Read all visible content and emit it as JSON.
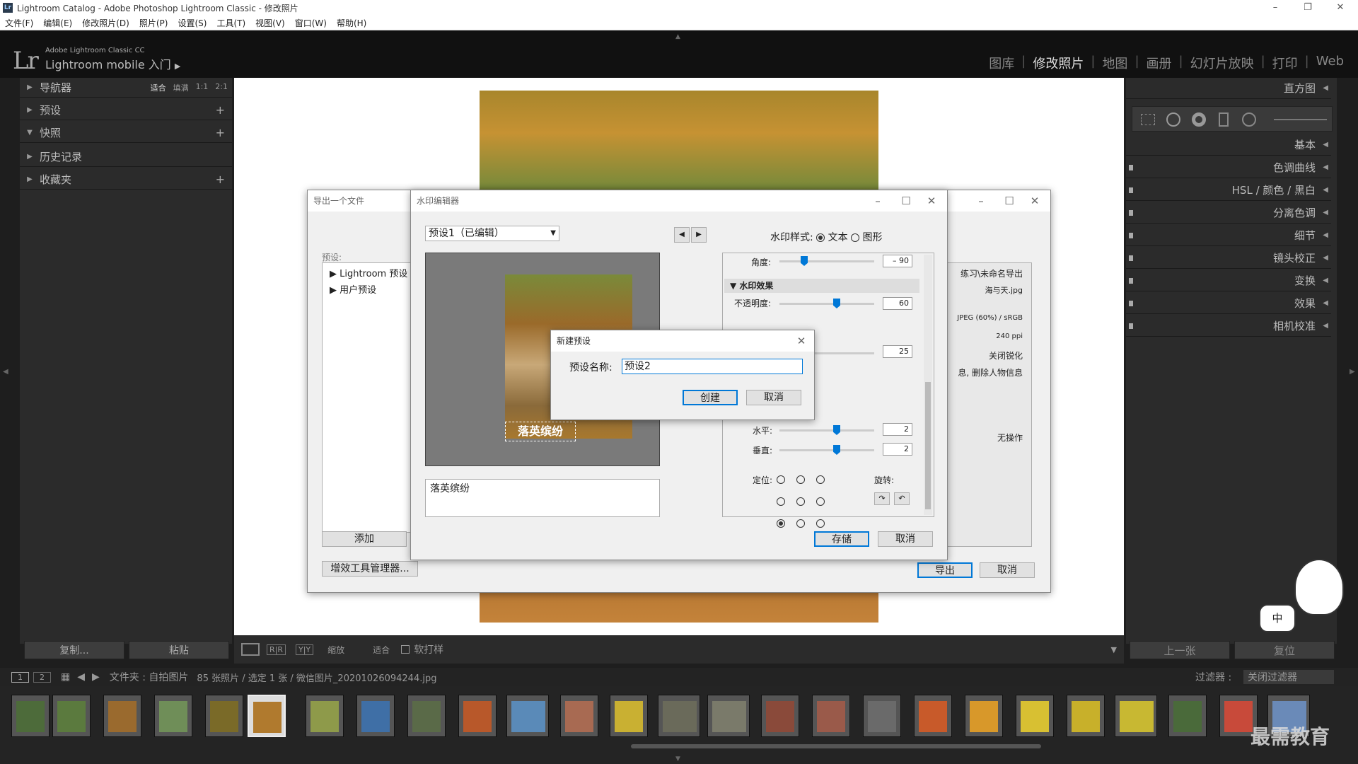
{
  "window": {
    "title": "Lightroom Catalog - Adobe Photoshop Lightroom Classic - 修改照片",
    "minimize": "–",
    "restore": "❐",
    "close": "✕"
  },
  "menu": [
    "文件(F)",
    "编辑(E)",
    "修改照片(D)",
    "照片(P)",
    "设置(S)",
    "工具(T)",
    "视图(V)",
    "窗口(W)",
    "帮助(H)"
  ],
  "brand": {
    "logo": "Lr",
    "line1": "Adobe Lightroom Classic CC",
    "line2": "Lightroom mobile 入门",
    "arrow": "▶"
  },
  "modules": [
    {
      "label": "图库",
      "active": false
    },
    {
      "label": "修改照片",
      "active": true
    },
    {
      "label": "地图",
      "active": false
    },
    {
      "label": "画册",
      "active": false
    },
    {
      "label": "幻灯片放映",
      "active": false
    },
    {
      "label": "打印",
      "active": false
    },
    {
      "label": "Web",
      "active": false
    }
  ],
  "left_panel": {
    "navigator": {
      "label": "导航器",
      "opts": [
        "适合",
        "填满",
        "1:1",
        "2:1"
      ]
    },
    "presets": {
      "label": "预设"
    },
    "snapshots": {
      "label": "快照"
    },
    "history": {
      "label": "历史记录"
    },
    "collections": {
      "label": "收藏夹"
    },
    "copy_btn": "复制...",
    "paste_btn": "粘贴"
  },
  "right_panel": {
    "histogram": "直方图",
    "items": [
      "基本",
      "色调曲线",
      "HSL / 颜色 / 黑白",
      "分离色调",
      "细节",
      "镜头校正",
      "变换",
      "效果",
      "相机校准"
    ],
    "prev_btn": "上一张",
    "reset_btn": "复位"
  },
  "toolbar": {
    "zoom_label": "缩放",
    "zoom_value": "适合",
    "softproof": "软打样"
  },
  "filmbar": {
    "page1": "1",
    "page2": "2",
    "path": "文件夹 : 自拍图片",
    "count": "85 张照片 / 选定 1 张 / 微信图片_20201026094244.jpg",
    "filter_label": "过滤器 :",
    "filter_value": "关闭过滤器"
  },
  "export_dialog": {
    "title": "导出一个文件",
    "preset_label": "预设:",
    "tree": [
      "Lightroom 预设",
      "用户预设"
    ],
    "add_btn": "添加",
    "plugin_btn": "增效工具管理器...",
    "export_btn": "导出",
    "cancel_btn": "取消",
    "right_values": [
      "练习\\未命名导出",
      "海与天.jpg",
      "JPEG (60%) / sRGB",
      "240 ppi",
      "关闭锐化",
      "息, 删除人物信息",
      "无操作"
    ]
  },
  "watermark_editor": {
    "title": "水印编辑器",
    "preset_select": "预设1（已编辑）",
    "style_label": "水印样式:",
    "style_text": "文本",
    "style_graphic": "图形",
    "angle_label": "角度:",
    "angle_value": "– 90",
    "effects_header": "水印效果",
    "opacity_label": "不透明度:",
    "opacity_value": "60",
    "size_value": "25",
    "horiz_label": "水平:",
    "horiz_value": "2",
    "vert_label": "垂直:",
    "vert_value": "2",
    "anchor_label": "定位:",
    "rotate_label": "旋转:",
    "text_content": "落英缤纷",
    "preview_text": "落英缤纷",
    "save_btn": "存储",
    "cancel_btn": "取消"
  },
  "new_preset_dialog": {
    "title": "新建预设",
    "name_label": "预设名称:",
    "name_value": "预设2",
    "create_btn": "创建",
    "cancel_btn": "取消"
  },
  "overlay": {
    "ime": "中",
    "watermark": "最需教育"
  }
}
